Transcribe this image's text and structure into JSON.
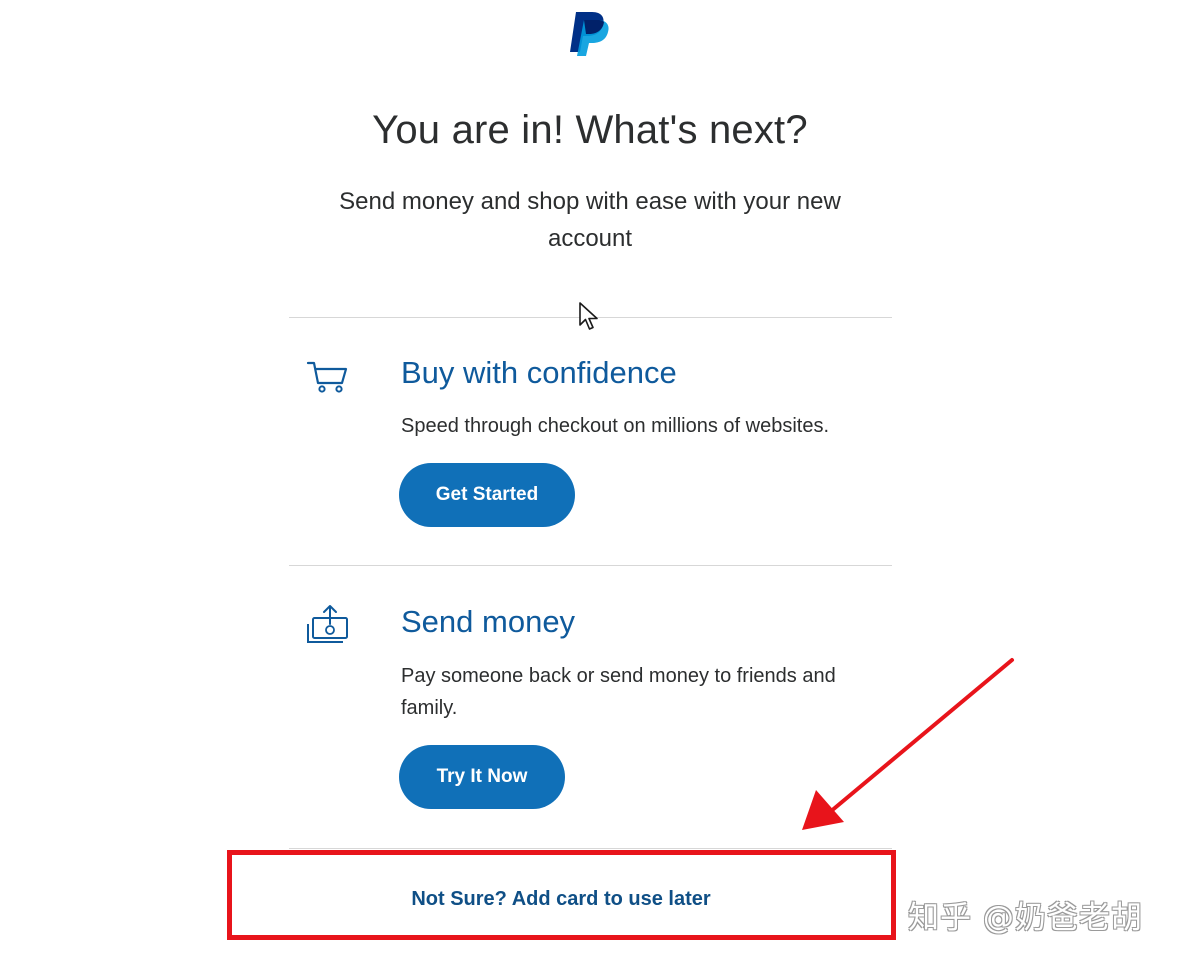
{
  "header": {
    "logo_icon": "paypal-logo-icon"
  },
  "main": {
    "title": "You are in! What's next?",
    "subtitle": "Send money and shop with ease with your new account"
  },
  "sections": [
    {
      "icon": "shopping-cart-icon",
      "title": "Buy with confidence",
      "description": "Speed through checkout on millions of websites.",
      "button_label": "Get Started"
    },
    {
      "icon": "send-money-icon",
      "title": "Send money",
      "description": "Pay someone back or send money to friends and family.",
      "button_label": "Try It Now"
    }
  ],
  "footer": {
    "link_label": "Not Sure? Add card to use later"
  },
  "annotations": {
    "watermark": "知乎 @奶爸老胡",
    "highlight_color": "#e8141b"
  },
  "colors": {
    "brand_blue": "#1070b8",
    "heading_blue": "#0f5a9c",
    "text": "#2c2e2f"
  }
}
